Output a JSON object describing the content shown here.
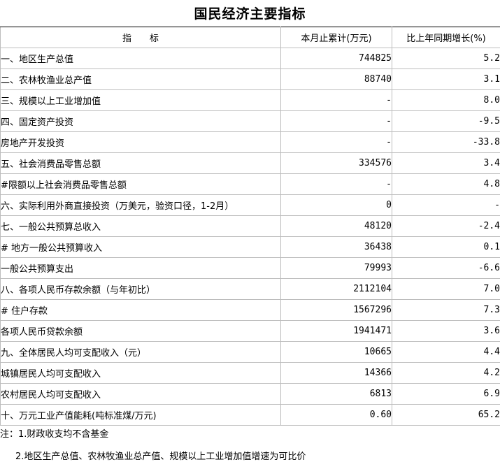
{
  "title": "国民经济主要指标",
  "columns": {
    "indicator": "指　　标",
    "cumulative": "本月止累计(万元)",
    "growth": "比上年同期增长(%)"
  },
  "rows": [
    {
      "label": "一、地区生产总值",
      "value": "744825",
      "growth": "5.2",
      "indent": 0
    },
    {
      "label": "二、农林牧渔业总产值",
      "value": "88740",
      "growth": "3.1",
      "indent": 0
    },
    {
      "label": "三、规模以上工业增加值",
      "value": "-",
      "growth": "8.0",
      "indent": 0
    },
    {
      "label": "四、固定资产投资",
      "value": "-",
      "growth": "-9.5",
      "indent": 0
    },
    {
      "label": "房地产开发投资",
      "value": "-",
      "growth": "-33.8",
      "indent": 1
    },
    {
      "label": "五、社会消费品零售总额",
      "value": "334576",
      "growth": "3.4",
      "indent": 0
    },
    {
      "label": "#限额以上社会消费品零售总额",
      "value": "-",
      "growth": "4.8",
      "indent": 2
    },
    {
      "label": "六、实际利用外商直接投资（万美元，验资口径，1-2月）",
      "value": "0",
      "growth": "-",
      "indent": 0
    },
    {
      "label": "七、一般公共预算总收入",
      "value": "48120",
      "growth": "-2.4",
      "indent": 0
    },
    {
      "label": "# 地方一般公共预算收入",
      "value": "36438",
      "growth": "0.1",
      "indent": 2
    },
    {
      "label": "一般公共预算支出",
      "value": "79993",
      "growth": "-6.6",
      "indent": 1
    },
    {
      "label": "八、各项人民币存款余额（与年初比）",
      "value": "2112104",
      "growth": "7.0",
      "indent": 0
    },
    {
      "label": "# 住户存款",
      "value": "1567296",
      "growth": "7.3",
      "indent": 3
    },
    {
      "label": "各项人民币贷款余额",
      "value": "1941471",
      "growth": "3.6",
      "indent": 1
    },
    {
      "label": "九、全体居民人均可支配收入（元）",
      "value": "10665",
      "growth": "4.4",
      "indent": 0
    },
    {
      "label": "城镇居民人均可支配收入",
      "value": "14366",
      "growth": "4.2",
      "indent": 3
    },
    {
      "label": "农村居民人均可支配收入",
      "value": "6813",
      "growth": "6.9",
      "indent": 1
    },
    {
      "label": "十、万元工业产值能耗(吨标准煤/万元)",
      "value": "0.60",
      "growth": "65.2",
      "indent": 0
    }
  ],
  "notes": [
    "注：1.财政收支均不含基金",
    "2.地区生产总值、农林牧渔业总产值、规模以上工业增加值增速为可比价"
  ]
}
